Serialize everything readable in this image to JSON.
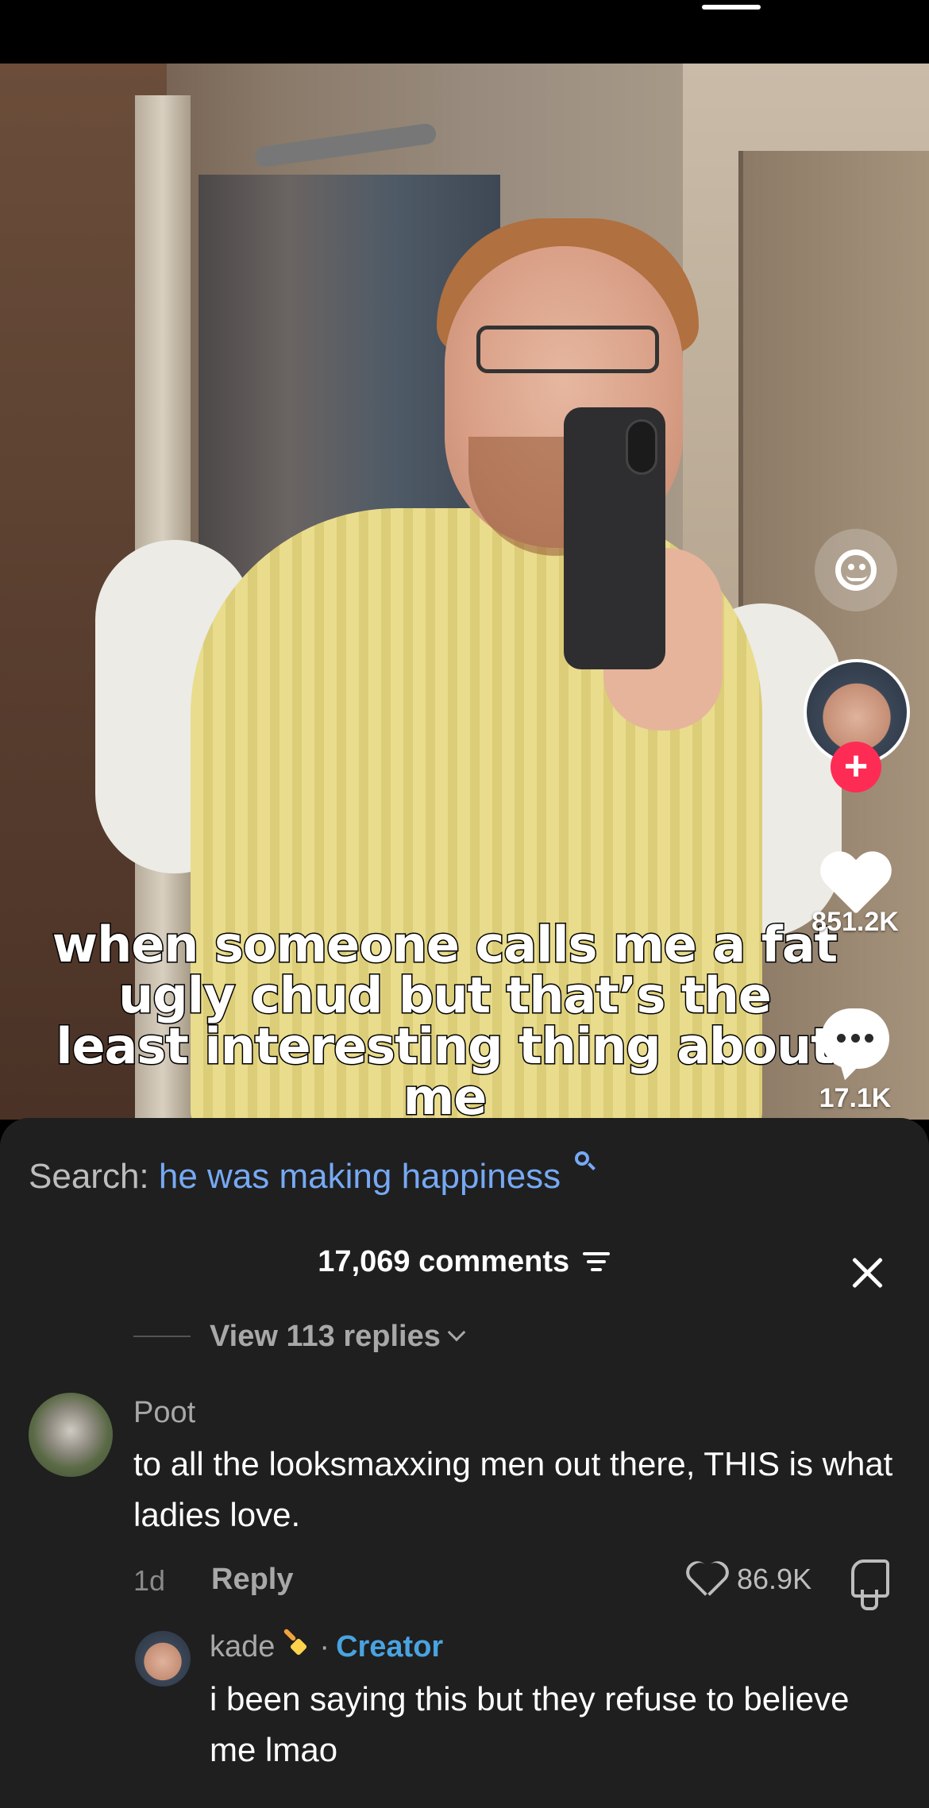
{
  "video": {
    "caption": "when someone calls me a fat ugly chud but that’s the least interesting thing about me",
    "likes": "851.2K",
    "comments": "17.1K",
    "follow_symbol": "+"
  },
  "comments_sheet": {
    "search_label": "Search:",
    "search_term": "he was making happiness",
    "count_label": "17,069 comments",
    "view_replies": "View 113 replies",
    "comment": {
      "user": "Poot",
      "text": "to all the looksmaxxing men out there, THIS is what ladies love.",
      "age": "1d",
      "reply_label": "Reply",
      "likes": "86.9K"
    },
    "reply": {
      "user": "kade",
      "separator": "·",
      "badge": "Creator",
      "text": "i been saying this but they refuse to believe me lmao"
    }
  },
  "colors": {
    "accent_link": "#76a9f4",
    "creator_badge": "#49a3e0",
    "follow_red": "#fe2c55",
    "sheet_bg": "#1f1f1f"
  },
  "icons": [
    "search-icon",
    "sort-icon",
    "close-icon",
    "chevron-down-icon",
    "heart-icon",
    "comment-bubble-icon",
    "filter-face-icon",
    "plus-icon",
    "dislike-icon",
    "sparkle-icon"
  ]
}
